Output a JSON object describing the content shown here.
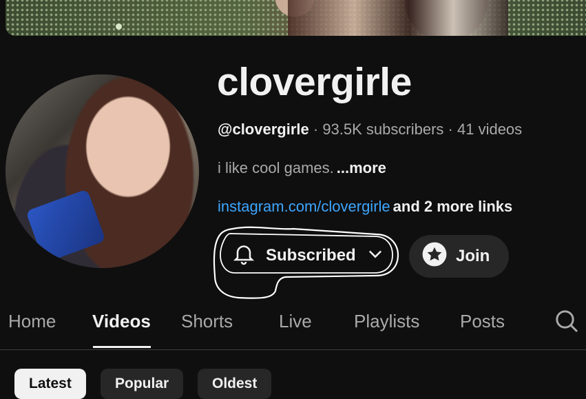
{
  "channel": {
    "name": "clovergirle",
    "handle": "@clovergirle",
    "subscribers": "93.5K subscribers",
    "videos": "41 videos",
    "description": "i like cool games.",
    "more_label": "...more",
    "link_text": "instagram.com/clovergirle",
    "extra_links": "and 2 more links"
  },
  "actions": {
    "subscribed_label": "Subscribed",
    "join_label": "Join"
  },
  "tabs": [
    {
      "label": "Home",
      "active": false
    },
    {
      "label": "Videos",
      "active": true
    },
    {
      "label": "Shorts",
      "active": false
    },
    {
      "label": "Live",
      "active": false
    },
    {
      "label": "Playlists",
      "active": false
    },
    {
      "label": "Posts",
      "active": false
    }
  ],
  "chips": [
    {
      "label": "Latest",
      "active": true
    },
    {
      "label": "Popular",
      "active": false
    },
    {
      "label": "Oldest",
      "active": false
    }
  ],
  "meta_separator": "·",
  "icons": {
    "bell": "bell-icon",
    "chevron": "chevron-down-icon",
    "star": "star-icon",
    "search": "search-icon"
  },
  "colors": {
    "background": "#0f0f0f",
    "text_primary": "#f1f1f1",
    "text_secondary": "#aaaaaa",
    "link": "#3ea6ff",
    "button_bg": "#272727"
  }
}
